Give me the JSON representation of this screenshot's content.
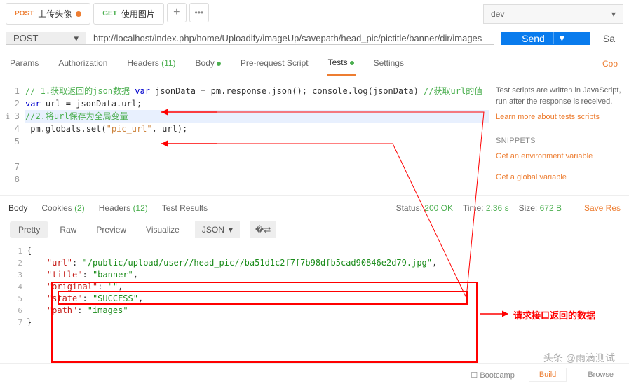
{
  "tabs": [
    {
      "method": "POST",
      "label": "上传头像",
      "dirty": true
    },
    {
      "method": "GET",
      "label": "使用图片",
      "dirty": false
    }
  ],
  "env": {
    "selected": "dev"
  },
  "request": {
    "method": "POST",
    "url": "http://localhost/index.php/home/Uploadify/imageUp/savepath/head_pic/pictitle/banner/dir/images",
    "send_label": "Send",
    "save_label": "Sa"
  },
  "req_tabs": {
    "params": "Params",
    "auth": "Authorization",
    "headers": "Headers",
    "headers_count": "(11)",
    "body": "Body",
    "prerequest": "Pre-request Script",
    "tests": "Tests",
    "settings": "Settings",
    "cookies": "Coo"
  },
  "editor": {
    "lines": [
      "// 1.获取返回的json数据",
      "var jsonData = pm.response.json();",
      "console.log(jsonData)",
      "//获取url的值",
      "var url = jsonData.url;",
      "",
      "//2.将url保存为全局变量",
      " pm.globals.set(\"pic_url\", url);"
    ]
  },
  "sidebar": {
    "intro1": "Test scripts are written in JavaScript,",
    "intro2": "run after the response is received.",
    "learn": "Learn more about tests scripts",
    "snippets_title": "SNIPPETS",
    "snip1": "Get an environment variable",
    "snip2": "Get a global variable"
  },
  "resp_tabs": {
    "body": "Body",
    "cookies": "Cookies",
    "cookies_count": "(2)",
    "headers": "Headers",
    "headers_count": "(12)",
    "tests": "Test Results"
  },
  "status": {
    "label": "Status:",
    "code": "200 OK",
    "time_label": "Time:",
    "time": "2.36 s",
    "size_label": "Size:",
    "size": "672 B",
    "save": "Save Res"
  },
  "view": {
    "pretty": "Pretty",
    "raw": "Raw",
    "preview": "Preview",
    "visualize": "Visualize",
    "format": "JSON"
  },
  "response_json": {
    "url": "/public/upload/user//head_pic//ba51d1c2f7f7b98dfb5cad90846e2d79.jpg",
    "title": "banner",
    "original": "",
    "state": "SUCCESS",
    "path": "images"
  },
  "annotation": "请求接口返回的数据",
  "watermark": "头条 @雨滴测试",
  "footer": {
    "bootcamp": "Bootcamp",
    "build": "Build",
    "browse": "Browse"
  }
}
